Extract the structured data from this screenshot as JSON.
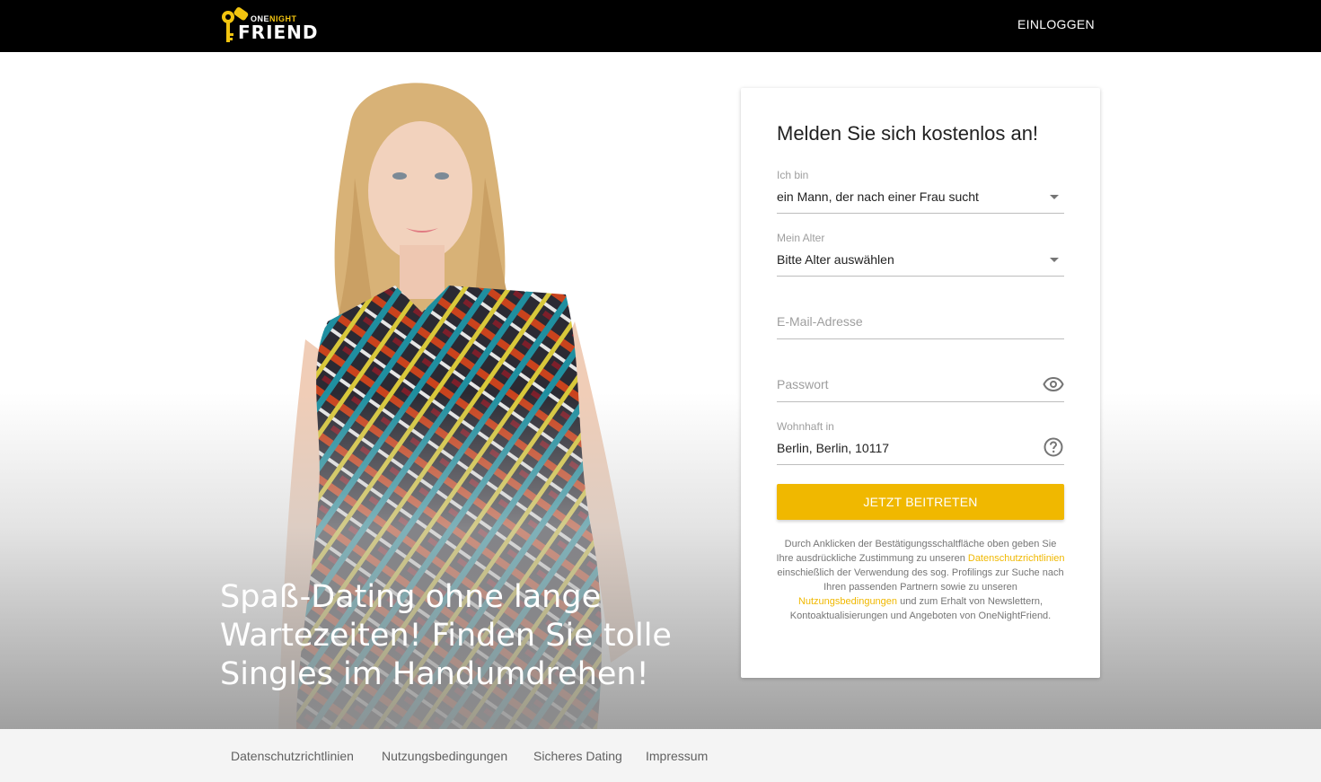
{
  "brand": {
    "line1_a": "ONE",
    "line1_b": "NIGHT",
    "line2": "FRIEND"
  },
  "header": {
    "login_label": "EINLOGGEN"
  },
  "hero": {
    "headline": "Spaß-Dating ohne lange Wartezeiten! Finden Sie tolle Singles im Handumdrehen!"
  },
  "form": {
    "title": "Melden Sie sich kostenlos an!",
    "iam": {
      "label": "Ich bin",
      "value": "ein Mann, der nach einer Frau sucht"
    },
    "age": {
      "label": "Mein Alter",
      "value": "Bitte Alter auswählen"
    },
    "email": {
      "placeholder": "E-Mail-Adresse"
    },
    "password": {
      "placeholder": "Passwort"
    },
    "location": {
      "label": "Wohnhaft in",
      "value": "Berlin, Berlin, 10117"
    },
    "submit_label": "JETZT BEITRETEN",
    "legal": {
      "part1": "Durch Anklicken der Bestätigungsschaltfläche oben geben Sie Ihre ausdrückliche Zustimmung zu unseren ",
      "link1": "Datenschutzrichtlinien",
      "part2": " einschießlich der Verwendung des sog. Profilings zur Suche nach Ihren passenden Partnern sowie zu unseren ",
      "link2": "Nutzungsbedingungen",
      "part3": " und zum Erhalt von Newslettern, Kontoaktualisierungen und Angeboten von OneNightFriend."
    }
  },
  "footer": {
    "links": [
      "Datenschutzrichtlinien",
      "Nutzungsbedingungen",
      "Sicheres Dating",
      "Impressum"
    ]
  },
  "colors": {
    "accent": "#f0b800",
    "header_bg": "#000000",
    "footer_bg": "#f4f4f4"
  },
  "icons": {
    "password_toggle": "eye-icon",
    "location_help": "help-circle-icon",
    "brand": "key-logo-icon"
  }
}
